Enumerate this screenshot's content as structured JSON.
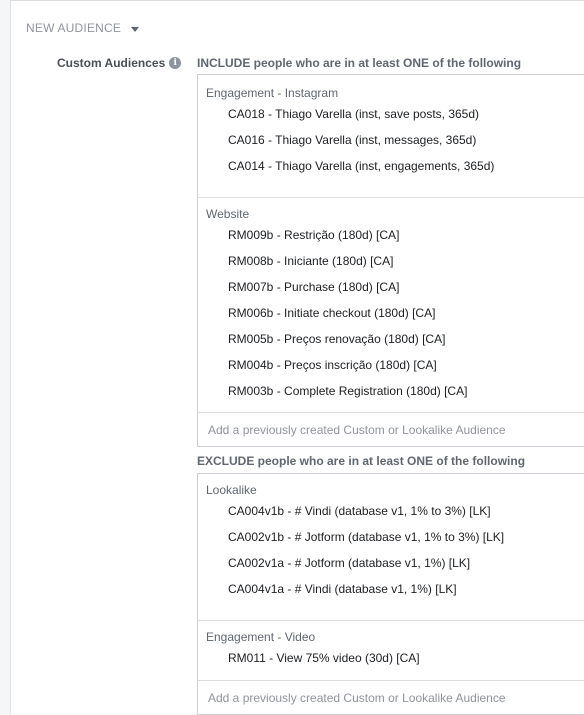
{
  "header": {
    "title": "NEW AUDIENCE"
  },
  "custom_audiences": {
    "label": "Custom Audiences",
    "include": {
      "heading": "INCLUDE people who are in at least ONE of the following",
      "groups": [
        {
          "title": "Engagement - Instagram",
          "items": [
            "CA018 - Thiago Varella (inst, save posts, 365d)",
            "CA016 - Thiago Varella (inst, messages, 365d)",
            "CA014 - Thiago Varella (inst, engagements, 365d)"
          ]
        },
        {
          "title": "Website",
          "items": [
            "RM009b - Restrição (180d) [CA]",
            "RM008b - Iniciante (180d) [CA]",
            "RM007b - Purchase (180d) [CA]",
            "RM006b - Initiate checkout (180d) [CA]",
            "RM005b - Preços renovação (180d) [CA]",
            "RM004b - Preços inscrição (180d) [CA]",
            "RM003b - Complete Registration (180d) [CA]"
          ]
        }
      ],
      "placeholder": "Add a previously created Custom or Lookalike Audience"
    },
    "exclude": {
      "heading": "EXCLUDE people who are in at least ONE of the following",
      "groups": [
        {
          "title": "Lookalike",
          "items": [
            "CA004v1b - # Vindi (database v1, 1% to 3%) [LK]",
            "CA002v1b - # Jotform (database v1, 1% to 3%) [LK]",
            "CA002v1a - # Jotform (database v1, 1%) [LK]",
            "CA004v1a - # Vindi (database v1, 1%) [LK]"
          ]
        },
        {
          "title": "Engagement - Video",
          "items": [
            "RM011 - View 75% video (30d) [CA]"
          ]
        }
      ],
      "placeholder": "Add a previously created Custom or Lookalike Audience"
    }
  }
}
